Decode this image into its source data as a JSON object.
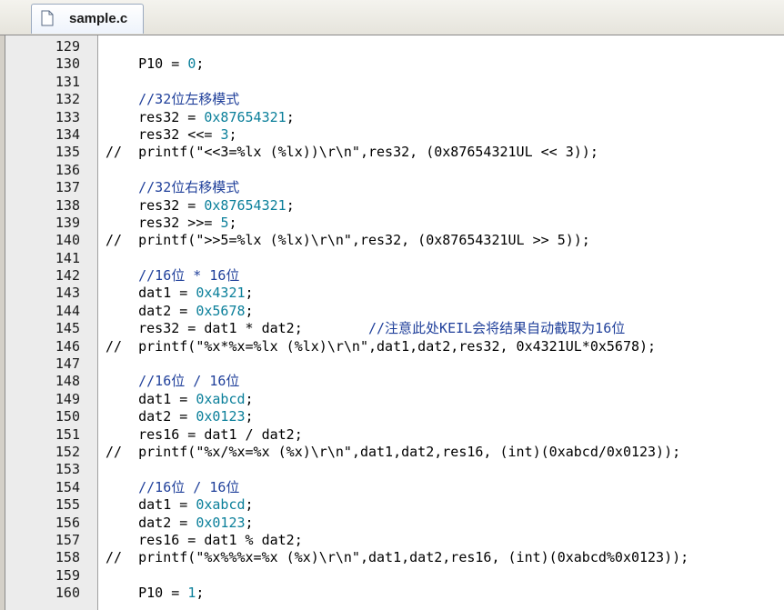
{
  "tab": {
    "label": "sample.c",
    "icon": "file-icon"
  },
  "colors": {
    "number": "#0a7f9a",
    "comment": "#1f3f9a",
    "text": "#000000",
    "gutter": "#ececec"
  },
  "lines": [
    {
      "no": "129",
      "code": ""
    },
    {
      "no": "130",
      "code": "    P10 = 0;"
    },
    {
      "no": "131",
      "code": ""
    },
    {
      "no": "132",
      "code": "    //32位左移模式"
    },
    {
      "no": "133",
      "code": "    res32 = 0x87654321;"
    },
    {
      "no": "134",
      "code": "    res32 <<= 3;"
    },
    {
      "no": "135",
      "code": "//  printf(\"<<3=%lx (%lx))\\r\\n\",res32, (0x87654321UL << 3));"
    },
    {
      "no": "136",
      "code": ""
    },
    {
      "no": "137",
      "code": "    //32位右移模式"
    },
    {
      "no": "138",
      "code": "    res32 = 0x87654321;"
    },
    {
      "no": "139",
      "code": "    res32 >>= 5;"
    },
    {
      "no": "140",
      "code": "//  printf(\">>5=%lx (%lx)\\r\\n\",res32, (0x87654321UL >> 5));"
    },
    {
      "no": "141",
      "code": ""
    },
    {
      "no": "142",
      "code": "    //16位 * 16位"
    },
    {
      "no": "143",
      "code": "    dat1 = 0x4321;"
    },
    {
      "no": "144",
      "code": "    dat2 = 0x5678;"
    },
    {
      "no": "145",
      "code": "    res32 = dat1 * dat2;        //注意此处KEIL会将结果自动截取为16位"
    },
    {
      "no": "146",
      "code": "//  printf(\"%x*%x=%lx (%lx)\\r\\n\",dat1,dat2,res32, 0x4321UL*0x5678);"
    },
    {
      "no": "147",
      "code": ""
    },
    {
      "no": "148",
      "code": "    //16位 / 16位"
    },
    {
      "no": "149",
      "code": "    dat1 = 0xabcd;"
    },
    {
      "no": "150",
      "code": "    dat2 = 0x0123;"
    },
    {
      "no": "151",
      "code": "    res16 = dat1 / dat2;"
    },
    {
      "no": "152",
      "code": "//  printf(\"%x/%x=%x (%x)\\r\\n\",dat1,dat2,res16, (int)(0xabcd/0x0123));"
    },
    {
      "no": "153",
      "code": ""
    },
    {
      "no": "154",
      "code": "    //16位 / 16位"
    },
    {
      "no": "155",
      "code": "    dat1 = 0xabcd;"
    },
    {
      "no": "156",
      "code": "    dat2 = 0x0123;"
    },
    {
      "no": "157",
      "code": "    res16 = dat1 % dat2;"
    },
    {
      "no": "158",
      "code": "//  printf(\"%x%%%x=%x (%x)\\r\\n\",dat1,dat2,res16, (int)(0xabcd%0x0123));"
    },
    {
      "no": "159",
      "code": ""
    },
    {
      "no": "160",
      "code": "    P10 = 1;"
    }
  ]
}
